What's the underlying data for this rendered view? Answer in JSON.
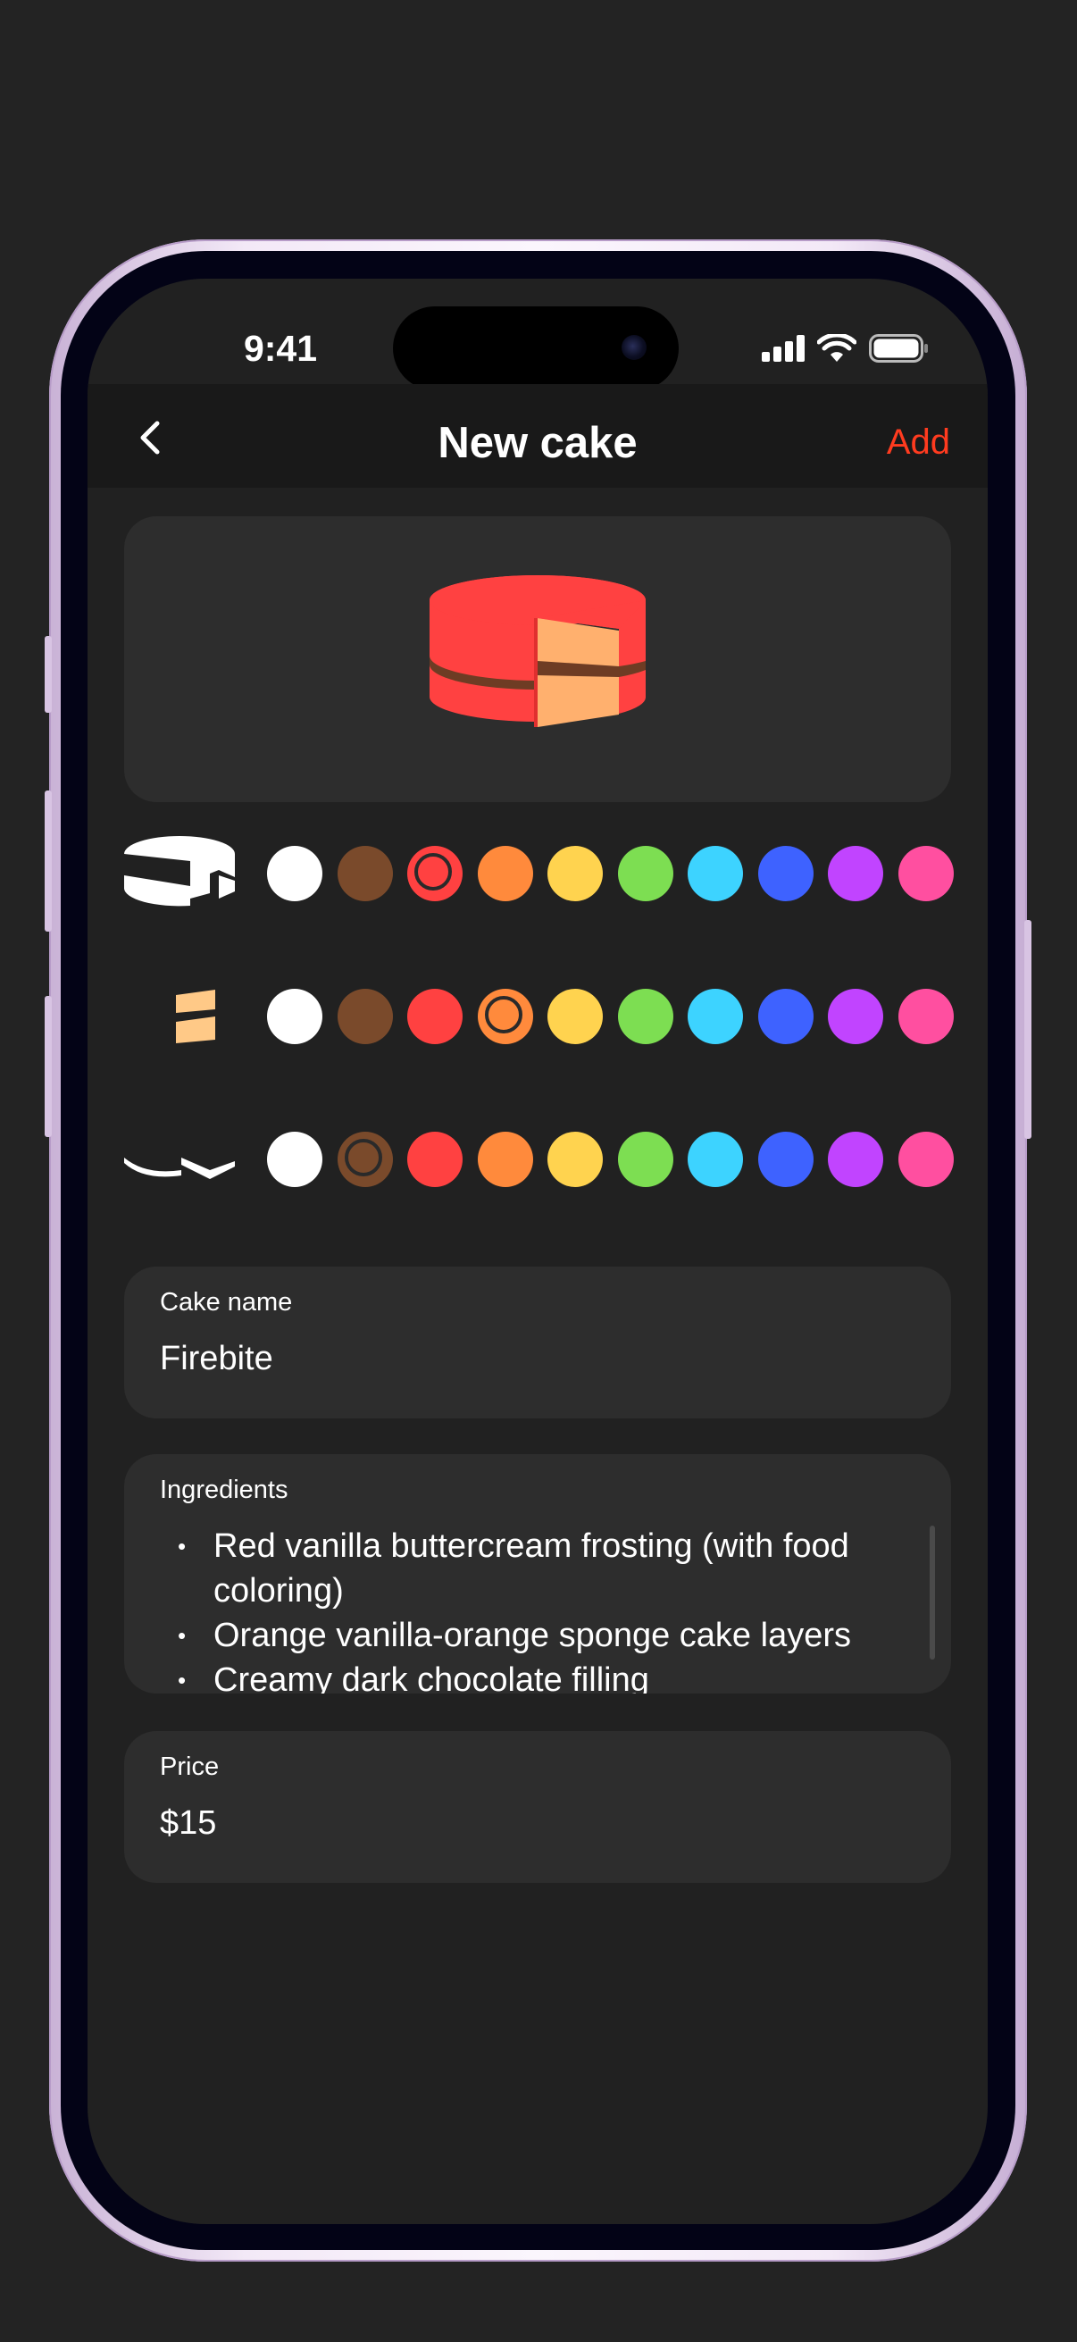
{
  "status_bar": {
    "time": "9:41"
  },
  "nav": {
    "title": "New cake",
    "add_label": "Add"
  },
  "pickers": {
    "colors": [
      "#ffffff",
      "#7a4a2b",
      "#ff4141",
      "#ff8a3c",
      "#ffd34f",
      "#7dde52",
      "#3dd3ff",
      "#3e62ff",
      "#c144ff",
      "#ff4fa0"
    ],
    "rows": [
      {
        "part": "frosting",
        "selected_index": 2
      },
      {
        "part": "sponge",
        "selected_index": 3
      },
      {
        "part": "filling",
        "selected_index": 1
      }
    ]
  },
  "form": {
    "name": {
      "label": "Cake name",
      "value": "Firebite"
    },
    "ingredients": {
      "label": "Ingredients",
      "items": [
        "Red vanilla buttercream frosting (with food coloring)",
        "Orange vanilla-orange sponge cake layers",
        "Creamy dark chocolate filling"
      ]
    },
    "price": {
      "label": "Price",
      "value": "$15"
    }
  },
  "colors": {
    "accent": "#ff3b1f",
    "frosting": "#ff4141",
    "sponge": "#ffb06e",
    "filling": "#7a4a2b"
  }
}
